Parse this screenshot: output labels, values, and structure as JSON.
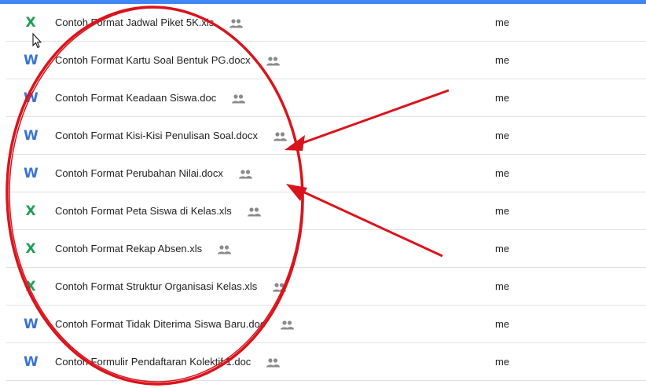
{
  "files": [
    {
      "name": "Contoh Format Jadwal Piket 5K.xls",
      "type": "excel",
      "type_letter": "X",
      "owner": "me",
      "shared": true
    },
    {
      "name": "Contoh Format Kartu Soal Bentuk PG.docx",
      "type": "word",
      "type_letter": "W",
      "owner": "me",
      "shared": true
    },
    {
      "name": "Contoh Format Keadaan Siswa.doc",
      "type": "word",
      "type_letter": "W",
      "owner": "me",
      "shared": true
    },
    {
      "name": "Contoh Format Kisi-Kisi Penulisan Soal.docx",
      "type": "word",
      "type_letter": "W",
      "owner": "me",
      "shared": true
    },
    {
      "name": "Contoh Format Perubahan Nilai.docx",
      "type": "word",
      "type_letter": "W",
      "owner": "me",
      "shared": true
    },
    {
      "name": "Contoh Format Peta Siswa di Kelas.xls",
      "type": "excel",
      "type_letter": "X",
      "owner": "me",
      "shared": true
    },
    {
      "name": "Contoh Format Rekap Absen.xls",
      "type": "excel",
      "type_letter": "X",
      "owner": "me",
      "shared": true
    },
    {
      "name": "Contoh Format Struktur Organisasi Kelas.xls",
      "type": "excel",
      "type_letter": "X",
      "owner": "me",
      "shared": true
    },
    {
      "name": "Contoh Format Tidak Diterima Siswa Baru.doc",
      "type": "word",
      "type_letter": "W",
      "owner": "me",
      "shared": true
    },
    {
      "name": "Contoh Formulir Pendaftaran Kolektif 1.doc",
      "type": "word",
      "type_letter": "W",
      "owner": "me",
      "shared": true
    }
  ],
  "colors": {
    "accent_bar": "#4285f4",
    "word": "#3b73d3",
    "excel": "#1d9d57",
    "annotation": "#d9141c",
    "shared_icon": "#8a8a8a"
  },
  "icons": {
    "word": "word-doc-icon",
    "excel": "excel-sheet-icon",
    "shared": "shared-people-icon",
    "pointer": "mouse-pointer-icon"
  }
}
